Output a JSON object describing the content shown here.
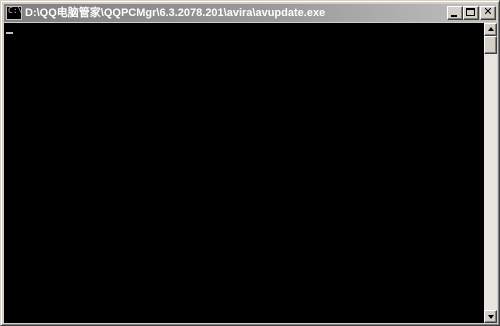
{
  "window": {
    "title": "D:\\QQ电脑管家\\QQPCMgr\\6.3.2078.201\\avira\\avupdate.exe",
    "icon": "console-icon",
    "controls": {
      "minimize_icon": "minimize-icon",
      "maximize_icon": "maximize-icon",
      "close_icon": "close-icon",
      "close_glyph": "✕"
    }
  },
  "console": {
    "background": "#000000",
    "text_color": "#c0c0c0",
    "content": "",
    "cursor": "_"
  },
  "scrollbar": {
    "up_icon": "scroll-up-arrow-icon",
    "down_icon": "scroll-down-arrow-icon"
  }
}
